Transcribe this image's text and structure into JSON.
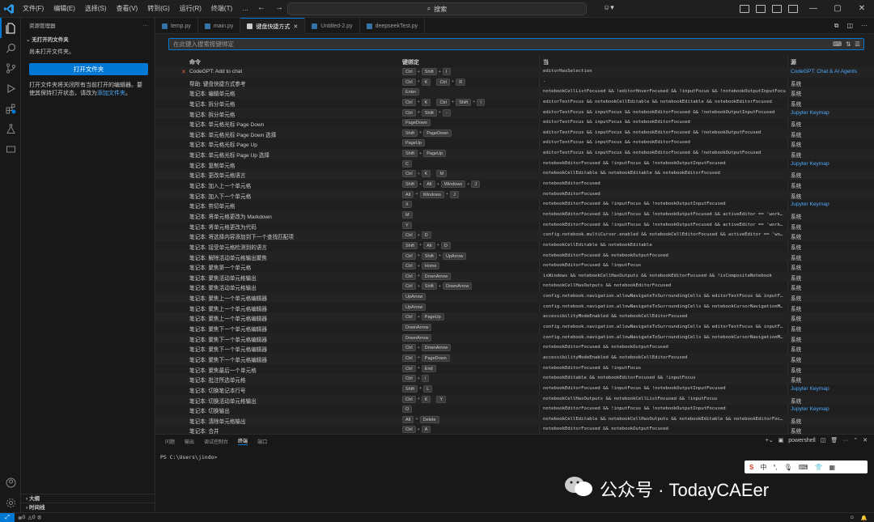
{
  "menu": [
    "文件(F)",
    "编辑(E)",
    "选择(S)",
    "查看(V)",
    "转到(G)",
    "运行(R)",
    "终端(T)",
    "…"
  ],
  "search": {
    "label": "搜索"
  },
  "sidebar": {
    "title": "资源管理器",
    "section": "无打开的文件夹",
    "no_folder_text": "尚未打开文件夹。",
    "open_button": "打开文件夹",
    "hint_text": "打开文件夹将关闭所有当前打开的编辑器。要使其保持打开状态，请改为",
    "hint_link": "添加文件夹",
    "hint_end": "。",
    "outline": "大纲",
    "timeline": "时间线"
  },
  "tabs": [
    {
      "label": "temp.py"
    },
    {
      "label": "main.py"
    },
    {
      "label": "键盘快捷方式"
    },
    {
      "label": "Untitled-2.py"
    },
    {
      "label": "deepseekTest.py"
    }
  ],
  "kb": {
    "search_placeholder": "在此键入搜索按键绑定",
    "headers": {
      "command": "命令",
      "keybinding": "键绑定",
      "when": "当",
      "source": "源"
    },
    "rows": [
      {
        "cmd": "CodeGPT: Add to chat",
        "keys": [
          [
            "Ctrl",
            "Shift",
            "I"
          ]
        ],
        "when": "editorHasSelection",
        "src": "CodeGPT: Chat & AI Agents",
        "ext": true
      },
      {
        "cmd": "帮助: 键盘快捷方式参考",
        "keys": [
          [
            "Ctrl",
            "K"
          ],
          [
            "Ctrl",
            "R"
          ]
        ],
        "when": "-",
        "src": "系统",
        "ext": false
      },
      {
        "cmd": "笔记本: 编辑单元格",
        "keys": [
          [
            "Enter"
          ]
        ],
        "when": "notebookCellListFocused && !editorHoverFocused && !inputFocus && !notebookOutputInputFocu…",
        "src": "系统",
        "ext": false
      },
      {
        "cmd": "笔记本: 拆分单元格",
        "keys": [
          [
            "Ctrl",
            "K"
          ],
          [
            "Ctrl",
            "Shift",
            "\\"
          ]
        ],
        "when": "editorTextFocus && notebookCellEditable && notebookEditable && notebookEditorFocused",
        "src": "系统",
        "ext": false
      },
      {
        "cmd": "笔记本: 拆分单元格",
        "keys": [
          [
            "Ctrl",
            "Shift",
            "-"
          ]
        ],
        "when": "editorTextFocus && inputFocus && notebookEditorFocused && !notebookOutputInputFocused",
        "src": "Jupyter Keymap",
        "ext": true
      },
      {
        "cmd": "笔记本: 单元格光标 Page Down",
        "keys": [
          [
            "PageDown"
          ]
        ],
        "when": "editorTextFocus && inputFocus && notebookEditorFocused",
        "src": "系统",
        "ext": false
      },
      {
        "cmd": "笔记本: 单元格光标 Page Down 选择",
        "keys": [
          [
            "Shift",
            "PageDown"
          ]
        ],
        "when": "editorTextFocus && inputFocus && notebookEditorFocused && !notebookOutputFocused",
        "src": "系统",
        "ext": false
      },
      {
        "cmd": "笔记本: 单元格光标 Page Up",
        "keys": [
          [
            "PageUp"
          ]
        ],
        "when": "editorTextFocus && inputFocus && notebookEditorFocused",
        "src": "系统",
        "ext": false
      },
      {
        "cmd": "笔记本: 单元格光标 Page Up 选择",
        "keys": [
          [
            "Shift",
            "PageUp"
          ]
        ],
        "when": "editorTextFocus && inputFocus && notebookEditorFocused && !notebookOutputFocused",
        "src": "系统",
        "ext": false
      },
      {
        "cmd": "笔记本: 复制单元格",
        "keys": [
          [
            "C"
          ]
        ],
        "when": "notebookEditorFocused && !inputFocus && !notebookOutputInputFocused",
        "src": "Jupyter Keymap",
        "ext": true
      },
      {
        "cmd": "笔记本: 更改单元格语言",
        "keys": [
          [
            "Ctrl",
            "K"
          ],
          [
            "M"
          ]
        ],
        "when": "notebookCellEditable && notebookEditable && notebookEditorFocused",
        "src": "系统",
        "ext": false
      },
      {
        "cmd": "笔记本: 加入上一个单元格",
        "keys": [
          [
            "Shift",
            "Alt",
            "Windows",
            "J"
          ]
        ],
        "when": "notebookEditorFocused",
        "src": "系统",
        "ext": false
      },
      {
        "cmd": "笔记本: 加入下一个单元格",
        "keys": [
          [
            "Alt",
            "Windows",
            "J"
          ]
        ],
        "when": "notebookEditorFocused",
        "src": "系统",
        "ext": false
      },
      {
        "cmd": "笔记本: 剪切单元格",
        "keys": [
          [
            "X"
          ]
        ],
        "when": "notebookEditorFocused && !inputFocus && !notebookOutputInputFocused",
        "src": "Jupyter Keymap",
        "ext": true
      },
      {
        "cmd": "笔记本: 将单元格更改为 Markdown",
        "keys": [
          [
            "M"
          ]
        ],
        "when": "notebookEditorFocused && !inputFocus && !notebookOutputFocused && activeEditor == 'work…",
        "src": "系统",
        "ext": false
      },
      {
        "cmd": "笔记本: 将单元格更改为代码",
        "keys": [
          [
            "Y"
          ]
        ],
        "when": "notebookEditorFocused && !inputFocus && !notebookOutputFocused && activeEditor == 'work…",
        "src": "系统",
        "ext": false
      },
      {
        "cmd": "笔记本: 将选择内容添加到下一个查找匹配项",
        "keys": [
          [
            "Ctrl",
            "D"
          ]
        ],
        "when": "config.notebook.multiCursor.enabled && notebookCellEditorFocused && activeEditor == 'wo…",
        "src": "系统",
        "ext": false
      },
      {
        "cmd": "笔记本: 接受单元格检测到的语言",
        "keys": [
          [
            "Shift",
            "Alt",
            "D"
          ]
        ],
        "when": "notebookCellEditable && notebookEditable",
        "src": "系统",
        "ext": false
      },
      {
        "cmd": "笔记本: 解除活动单元格输出聚焦",
        "keys": [
          [
            "Ctrl",
            "Shift",
            "UpArrow"
          ]
        ],
        "when": "notebookEditorFocused && notebookOutputFocused",
        "src": "系统",
        "ext": false
      },
      {
        "cmd": "笔记本: 聚焦第一个单元格",
        "keys": [
          [
            "Ctrl",
            "Home"
          ]
        ],
        "when": "notebookEditorFocused && !inputFocus",
        "src": "系统",
        "ext": false
      },
      {
        "cmd": "笔记本: 聚焦活动单元格输出",
        "keys": [
          [
            "Ctrl",
            "DownArrow"
          ]
        ],
        "when": "isWindows && notebookCellHasOutputs && notebookEditorFocused && !isCompositeNotebook",
        "src": "系统",
        "ext": false
      },
      {
        "cmd": "笔记本: 聚焦活动单元格输出",
        "keys": [
          [
            "Ctrl",
            "Shift",
            "DownArrow"
          ]
        ],
        "when": "notebookCellHasOutputs && notebookEditorFocused",
        "src": "系统",
        "ext": false
      },
      {
        "cmd": "笔记本: 聚焦上一个单元格编辑器",
        "keys": [
          [
            "UpArrow"
          ]
        ],
        "when": "config.notebook.navigation.allowNavigateToSurroundingCells && editorTextFocus && inputF…",
        "src": "系统",
        "ext": false
      },
      {
        "cmd": "笔记本: 聚焦上一个单元格编辑器",
        "keys": [
          [
            "UpArrow"
          ]
        ],
        "when": "config.notebook.navigation.allowNavigateToSurroundingCells && notebookCursorNavigationM…",
        "src": "系统",
        "ext": false
      },
      {
        "cmd": "笔记本: 聚焦上一个单元格编辑器",
        "keys": [
          [
            "Ctrl",
            "PageUp"
          ]
        ],
        "when": "accessibilityModeEnabled && notebookCellEditorFocused",
        "src": "系统",
        "ext": false
      },
      {
        "cmd": "笔记本: 聚焦下一个单元格编辑器",
        "keys": [
          [
            "DownArrow"
          ]
        ],
        "when": "config.notebook.navigation.allowNavigateToSurroundingCells && editorTextFocus && inputF…",
        "src": "系统",
        "ext": false
      },
      {
        "cmd": "笔记本: 聚焦下一个单元格编辑器",
        "keys": [
          [
            "DownArrow"
          ]
        ],
        "when": "config.notebook.navigation.allowNavigateToSurroundingCells && notebookCursorNavigationM…",
        "src": "系统",
        "ext": false
      },
      {
        "cmd": "笔记本: 聚焦下一个单元格编辑器",
        "keys": [
          [
            "Ctrl",
            "DownArrow"
          ]
        ],
        "when": "notebookEditorFocused && notebookOutputFocused",
        "src": "系统",
        "ext": false
      },
      {
        "cmd": "笔记本: 聚焦下一个单元格编辑器",
        "keys": [
          [
            "Ctrl",
            "PageDown"
          ]
        ],
        "when": "accessibilityModeEnabled && notebookCellEditorFocused",
        "src": "系统",
        "ext": false
      },
      {
        "cmd": "笔记本: 聚焦最后一个单元格",
        "keys": [
          [
            "Ctrl",
            "End"
          ]
        ],
        "when": "notebookEditorFocused && !inputFocus",
        "src": "系统",
        "ext": false
      },
      {
        "cmd": "笔记本: 批注所选单元格",
        "keys": [
          [
            "Ctrl",
            "/"
          ]
        ],
        "when": "notebookEditable && notebookEditorFocused && !inputFocus",
        "src": "系统",
        "ext": false
      },
      {
        "cmd": "笔记本: 切换笔记本行号",
        "keys": [
          [
            "Shift",
            "L"
          ]
        ],
        "when": "notebookEditorFocused && !inputFocus && !notebookOutputInputFocused",
        "src": "Jupyter Keymap",
        "ext": true
      },
      {
        "cmd": "笔记本: 切换活动单元格输出",
        "keys": [
          [
            "Ctrl",
            "K"
          ],
          [
            "Y"
          ]
        ],
        "when": "notebookCellHasOutputs && notebookCellListFocused && !inputFocus",
        "src": "系统",
        "ext": false
      },
      {
        "cmd": "笔记本: 切换输出",
        "keys": [
          [
            "O"
          ]
        ],
        "when": "notebookEditorFocused && !inputFocus && !notebookOutputInputFocused",
        "src": "Jupyter Keymap",
        "ext": true
      },
      {
        "cmd": "笔记本: 清除单元格输出",
        "keys": [
          [
            "Alt",
            "Delete"
          ]
        ],
        "when": "notebookCellEditable && notebookCellHasOutputs && notebookEditable && notebookEditorFoc…",
        "src": "系统",
        "ext": false
      },
      {
        "cmd": "笔记本: 合并",
        "keys": [
          [
            "Ctrl",
            "A"
          ]
        ],
        "when": "notebookEditorFocused && notebookOutputFocused",
        "src": "系统",
        "ext": false
      }
    ]
  },
  "panel": {
    "tabs": [
      "问题",
      "输出",
      "调试控制台",
      "终端",
      "端口"
    ],
    "active_tab": "终端",
    "shell": "powershell",
    "prompt": "PS C:\\Users\\jindo> "
  },
  "ime": {
    "items": [
      "中",
      "°,"
    ]
  },
  "watermark": {
    "text": "公众号 · TodayCAEer"
  },
  "status": {
    "errors": "0",
    "warnings": "0"
  },
  "colors": {
    "accent": "#0078d4",
    "link": "#4daafc"
  }
}
